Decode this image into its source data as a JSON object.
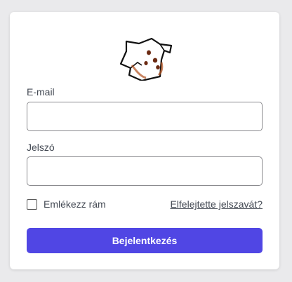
{
  "logo": {
    "icon": "dog-logo-icon"
  },
  "email": {
    "label": "E-mail",
    "value": "",
    "placeholder": ""
  },
  "password": {
    "label": "Jelszó",
    "value": "",
    "placeholder": ""
  },
  "remember": {
    "label": "Emlékezz rám",
    "checked": false
  },
  "forgot": {
    "label": "Elfelejtette jelszavát?"
  },
  "submit": {
    "label": "Bejelentkezés"
  },
  "colors": {
    "accent": "#5046e4",
    "background": "#eaeaec",
    "card": "#ffffff"
  }
}
